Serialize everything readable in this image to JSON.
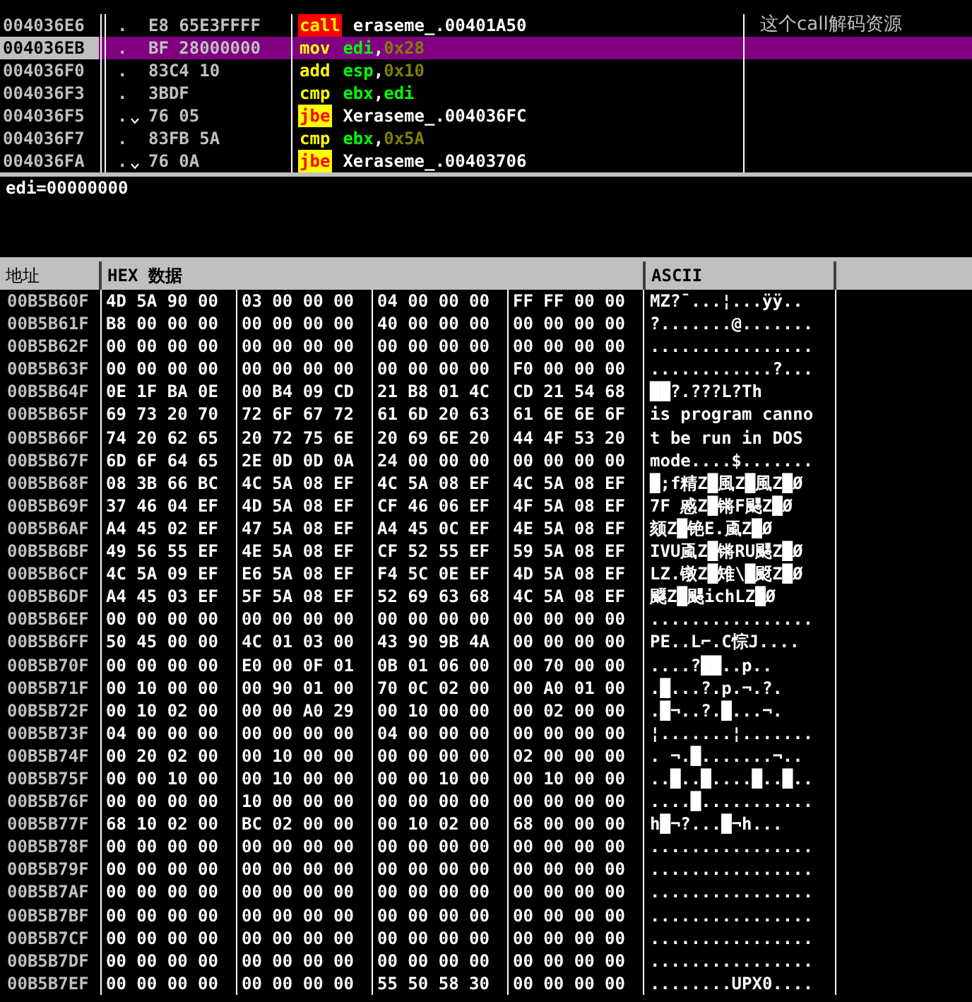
{
  "disassembly": {
    "rows": [
      {
        "marker": ".",
        "address": "004036E6",
        "selected": false,
        "jump_mark": false,
        "bytes": "E8 65E3FFFF",
        "kind": "call",
        "mnemonic": "call",
        "operands": [
          {
            "text": "eraseme_.00401A50",
            "kind": "plain"
          }
        ],
        "comment": "这个call解码资源"
      },
      {
        "marker": ".",
        "address": "004036EB",
        "selected": true,
        "jump_mark": false,
        "bytes": "BF 28000000",
        "kind": "normal",
        "mnemonic": "mov",
        "operands": [
          {
            "text": "edi",
            "kind": "reg"
          },
          {
            "text": ",",
            "kind": "plain"
          },
          {
            "text": "0x28",
            "kind": "imm"
          }
        ]
      },
      {
        "marker": ".",
        "address": "004036F0",
        "selected": false,
        "jump_mark": false,
        "bytes": "83C4 10",
        "kind": "normal",
        "mnemonic": "add",
        "operands": [
          {
            "text": "esp",
            "kind": "reg"
          },
          {
            "text": ",",
            "kind": "plain"
          },
          {
            "text": "0x10",
            "kind": "imm"
          }
        ]
      },
      {
        "marker": ".",
        "address": "004036F3",
        "selected": false,
        "jump_mark": false,
        "bytes": "3BDF",
        "kind": "normal",
        "mnemonic": "cmp",
        "operands": [
          {
            "text": "ebx",
            "kind": "reg"
          },
          {
            "text": ",",
            "kind": "plain"
          },
          {
            "text": "edi",
            "kind": "reg"
          }
        ]
      },
      {
        "marker": ".",
        "address": "004036F5",
        "selected": false,
        "jump_mark": true,
        "bytes": "76 05",
        "kind": "jump",
        "mnemonic": "jbe",
        "operands": [
          {
            "text": "Xeraseme_.004036FC",
            "kind": "plain"
          }
        ]
      },
      {
        "marker": ".",
        "address": "004036F7",
        "selected": false,
        "jump_mark": false,
        "bytes": "83FB 5A",
        "kind": "normal",
        "mnemonic": "cmp",
        "operands": [
          {
            "text": "ebx",
            "kind": "reg"
          },
          {
            "text": ",",
            "kind": "plain"
          },
          {
            "text": "0x5A",
            "kind": "imm"
          }
        ]
      },
      {
        "marker": ".",
        "address": "004036FA",
        "selected": false,
        "jump_mark": true,
        "bytes": "76 0A",
        "kind": "jump",
        "mnemonic": "jbe",
        "operands": [
          {
            "text": "Xeraseme_.00403706",
            "kind": "plain"
          }
        ]
      }
    ]
  },
  "info_panel": {
    "text": "edi=00000000"
  },
  "dump": {
    "columns": [
      "地址",
      "HEX 数据",
      "ASCII"
    ],
    "rows": [
      {
        "address": "00B5B60F",
        "hex": [
          "4D 5A 90 00",
          "03 00 00 00",
          "04 00 00 00",
          "FF FF 00 00"
        ],
        "ascii": "MZ?¯...¦...ÿÿ.."
      },
      {
        "address": "00B5B61F",
        "hex": [
          "B8 00 00 00",
          "00 00 00 00",
          "40 00 00 00",
          "00 00 00 00"
        ],
        "ascii": "?.......@......."
      },
      {
        "address": "00B5B62F",
        "hex": [
          "00 00 00 00",
          "00 00 00 00",
          "00 00 00 00",
          "00 00 00 00"
        ],
        "ascii": "................"
      },
      {
        "address": "00B5B63F",
        "hex": [
          "00 00 00 00",
          "00 00 00 00",
          "00 00 00 00",
          "F0 00 00 00"
        ],
        "ascii": "............?..."
      },
      {
        "address": "00B5B64F",
        "hex": [
          "0E 1F BA 0E",
          "00 B4 09 CD",
          "21 B8 01 4C",
          "CD 21 54 68"
        ],
        "ascii": "██?.???L?Th"
      },
      {
        "address": "00B5B65F",
        "hex": [
          "69 73 20 70",
          "72 6F 67 72",
          "61 6D 20 63",
          "61 6E 6E 6F"
        ],
        "ascii": "is program canno"
      },
      {
        "address": "00B5B66F",
        "hex": [
          "74 20 62 65",
          "20 72 75 6E",
          "20 69 6E 20",
          "44 4F 53 20"
        ],
        "ascii": "t be run in DOS"
      },
      {
        "address": "00B5B67F",
        "hex": [
          "6D 6F 64 65",
          "2E 0D 0D 0A",
          "24 00 00 00",
          "00 00 00 00"
        ],
        "ascii": "mode....$......."
      },
      {
        "address": "00B5B68F",
        "hex": [
          "08 3B 66 BC",
          "4C 5A 08 EF",
          "4C 5A 08 EF",
          "4C 5A 08 EF"
        ],
        "ascii": "█;f精Z█風Z█風Z█Ø"
      },
      {
        "address": "00B5B69F",
        "hex": [
          "37 46 04 EF",
          "4D 5A 08 EF",
          "CF 46 06 EF",
          "4F 5A 08 EF"
        ],
        "ascii": "7F 慼Z█锵F颸Z█Ø"
      },
      {
        "address": "00B5B6AF",
        "hex": [
          "A4 45 02 EF",
          "47 5A 08 EF",
          "A4 45 0C EF",
          "4E 5A 08 EF"
        ],
        "ascii": "  颏Z█铯E.颪Z█Ø"
      },
      {
        "address": "00B5B6BF",
        "hex": [
          "49 56 55 EF",
          "4E 5A 08 EF",
          "CF 52 55 EF",
          "59 5A 08 EF"
        ],
        "ascii": "IVU颪Z█锵RU颸Z█Ø"
      },
      {
        "address": "00B5B6CF",
        "hex": [
          "4C 5A 09 EF",
          "E6 5A 08 EF",
          "F4 5C 0E EF",
          "4D 5A 08 EF"
        ],
        "ascii": "LZ.镦Z█雉\\█颬Z█Ø"
      },
      {
        "address": "00B5B6DF",
        "hex": [
          "A4 45 03 EF",
          "5F 5A 08 EF",
          "52 69 63 68",
          "4C 5A 08 EF"
        ],
        "ascii": "  飋Z█颸ichLZ█Ø"
      },
      {
        "address": "00B5B6EF",
        "hex": [
          "00 00 00 00",
          "00 00 00 00",
          "00 00 00 00",
          "00 00 00 00"
        ],
        "ascii": "................"
      },
      {
        "address": "00B5B6FF",
        "hex": [
          "50 45 00 00",
          "4C 01 03 00",
          "43 90 9B 4A",
          "00 00 00 00"
        ],
        "ascii": "PE..L⌐.C悰J...."
      },
      {
        "address": "00B5B70F",
        "hex": [
          "00 00 00 00",
          "E0 00 0F 01",
          "0B 01 06 00",
          "00 70 00 00"
        ],
        "ascii": "....?██..p.."
      },
      {
        "address": "00B5B71F",
        "hex": [
          "00 10 00 00",
          "00 90 01 00",
          "70 0C 02 00",
          "00 A0 01 00"
        ],
        "ascii": ".█...?.p.¬.?."
      },
      {
        "address": "00B5B72F",
        "hex": [
          "00 10 02 00",
          "00 00 A0 29",
          "00 10 00 00",
          "00 02 00 00"
        ],
        "ascii": ".█¬..?.█...¬."
      },
      {
        "address": "00B5B73F",
        "hex": [
          "04 00 00 00",
          "00 00 00 00",
          "04 00 00 00",
          "00 00 00 00"
        ],
        "ascii": "¦.......¦......."
      },
      {
        "address": "00B5B74F",
        "hex": [
          "00 20 02 00",
          "00 10 00 00",
          "00 00 00 00",
          "02 00 00 00"
        ],
        "ascii": ". ¬.█.......¬.."
      },
      {
        "address": "00B5B75F",
        "hex": [
          "00 00 10 00",
          "00 10 00 00",
          "00 00 10 00",
          "00 10 00 00"
        ],
        "ascii": "..█..█....█..█.."
      },
      {
        "address": "00B5B76F",
        "hex": [
          "00 00 00 00",
          "10 00 00 00",
          "00 00 00 00",
          "00 00 00 00"
        ],
        "ascii": "....█..........."
      },
      {
        "address": "00B5B77F",
        "hex": [
          "68 10 02 00",
          "BC 02 00 00",
          "00 10 02 00",
          "68 00 00 00"
        ],
        "ascii": "h█¬?...█¬h..."
      },
      {
        "address": "00B5B78F",
        "hex": [
          "00 00 00 00",
          "00 00 00 00",
          "00 00 00 00",
          "00 00 00 00"
        ],
        "ascii": "................"
      },
      {
        "address": "00B5B79F",
        "hex": [
          "00 00 00 00",
          "00 00 00 00",
          "00 00 00 00",
          "00 00 00 00"
        ],
        "ascii": "................"
      },
      {
        "address": "00B5B7AF",
        "hex": [
          "00 00 00 00",
          "00 00 00 00",
          "00 00 00 00",
          "00 00 00 00"
        ],
        "ascii": "................"
      },
      {
        "address": "00B5B7BF",
        "hex": [
          "00 00 00 00",
          "00 00 00 00",
          "00 00 00 00",
          "00 00 00 00"
        ],
        "ascii": "................"
      },
      {
        "address": "00B5B7CF",
        "hex": [
          "00 00 00 00",
          "00 00 00 00",
          "00 00 00 00",
          "00 00 00 00"
        ],
        "ascii": "................"
      },
      {
        "address": "00B5B7DF",
        "hex": [
          "00 00 00 00",
          "00 00 00 00",
          "00 00 00 00",
          "00 00 00 00"
        ],
        "ascii": "................"
      },
      {
        "address": "00B5B7EF",
        "hex": [
          "00 00 00 00",
          "00 00 00 00",
          "55 50 58 30",
          "00 00 00 00"
        ],
        "ascii": "........UPX0...."
      }
    ]
  }
}
